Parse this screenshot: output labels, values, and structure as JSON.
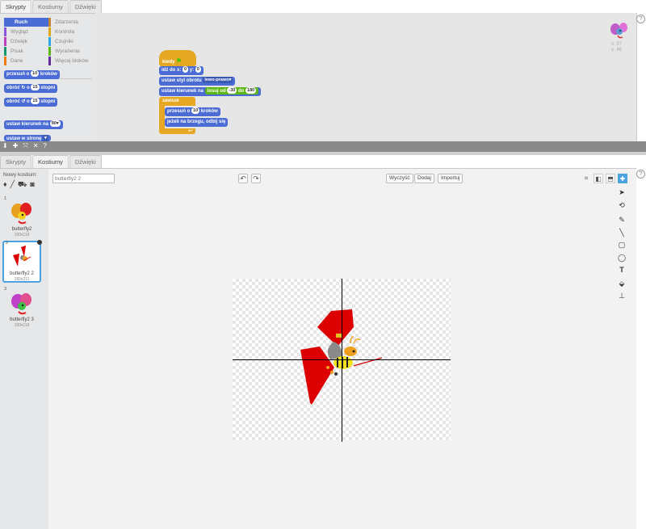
{
  "tabs": [
    "Skrypty",
    "Kostiumy",
    "Dźwięki"
  ],
  "top": {
    "active_tab": 0,
    "categories": [
      {
        "label": "Ruch",
        "color": "#4a6cd4",
        "selected": true
      },
      {
        "label": "Zdarzenia",
        "color": "#c88330",
        "selected": false
      },
      {
        "label": "Wygląd",
        "color": "#8a55d7",
        "selected": false
      },
      {
        "label": "Kontrola",
        "color": "#e1a91a",
        "selected": false
      },
      {
        "label": "Dźwięk",
        "color": "#bb42c3",
        "selected": false
      },
      {
        "label": "Czujniki",
        "color": "#2ca5e2",
        "selected": false
      },
      {
        "label": "Pisak",
        "color": "#0e9a6c",
        "selected": false
      },
      {
        "label": "Wyrażenia",
        "color": "#5cb712",
        "selected": false
      },
      {
        "label": "Dane",
        "color": "#ee7d16",
        "selected": false
      },
      {
        "label": "Więcej bloków",
        "color": "#632d99",
        "selected": false
      }
    ],
    "palette_blocks": {
      "move": {
        "text": "przesuń o",
        "value": "10",
        "suffix": "kroków"
      },
      "turn_right": {
        "text": "obróć",
        "value": "15",
        "suffix": "stopni"
      },
      "turn_left": {
        "text": "obróć",
        "value": "15",
        "suffix": "stopni"
      },
      "point_dir": {
        "text": "ustaw kierunek na",
        "value": "90"
      },
      "point_towards": {
        "text": "ustaw w stronę"
      }
    },
    "script": {
      "hat": "kiedy",
      "goto": {
        "text": "idź do x:",
        "x": "0",
        "ylabel": "y:",
        "y": "0"
      },
      "rotation_style": {
        "text": "ustaw styl obrotu",
        "value": "lewo-prawo"
      },
      "point_random": {
        "text": "ustaw kierunek na",
        "random_text": "losuj od",
        "from": "-30",
        "to_text": "do",
        "to": "180"
      },
      "forever": "zawsze",
      "forever_move": {
        "text": "przesuń o",
        "value": "10",
        "suffix": "kroków"
      },
      "bounce": "jeżeli na brzegu, odbij się"
    },
    "sprite_coords": {
      "x": "x: 97",
      "y": "y: 46"
    }
  },
  "bottom": {
    "active_tab": 1,
    "new_costume_label": "Nowy kostium:",
    "costume_name_value": "butterfly2 2",
    "buttons": {
      "clear": "Wyczyść",
      "add": "Dodaj",
      "import": "Importuj"
    },
    "costumes": [
      {
        "num": "1",
        "name": "butterfly2",
        "size": "100x110",
        "selected": false
      },
      {
        "num": "2",
        "name": "butterfly2 2",
        "size": "183x211",
        "selected": true
      },
      {
        "num": "3",
        "name": "butterfly2 3",
        "size": "100x110",
        "selected": false
      }
    ]
  },
  "colors": {
    "motion": "#4a6cd4",
    "control": "#e6a822",
    "operators": "#5cb712",
    "costume_red": "#dd0000"
  }
}
